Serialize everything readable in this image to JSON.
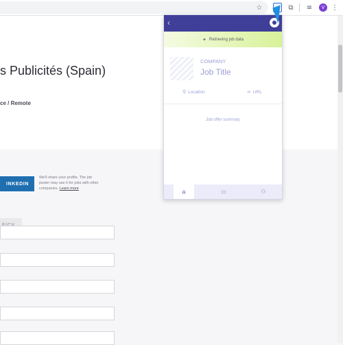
{
  "page": {
    "job_heading": "s Publicités (Spain)",
    "breadcrumb": "ce /  Remote",
    "linkedin_label": "INKEDIN",
    "profile_note": "We'll share your profile. The job poster may use it for jobs with other companies.",
    "learn_more": "Learn more",
    "cv_label": "E/CV"
  },
  "popup": {
    "status": "Retrieving job data",
    "company": "COMPANY",
    "job_title": "Job Title",
    "location": "Location",
    "url": "URL",
    "summary": "Job offer summary"
  },
  "toolbar": {
    "profile_initial": "V"
  },
  "colors": {
    "popup_header": "#3f3e98",
    "linkedin_button": "#1f6fb0",
    "banner_gradient_end": "#d8f29a",
    "placeholder_text": "#9a9fd6"
  }
}
